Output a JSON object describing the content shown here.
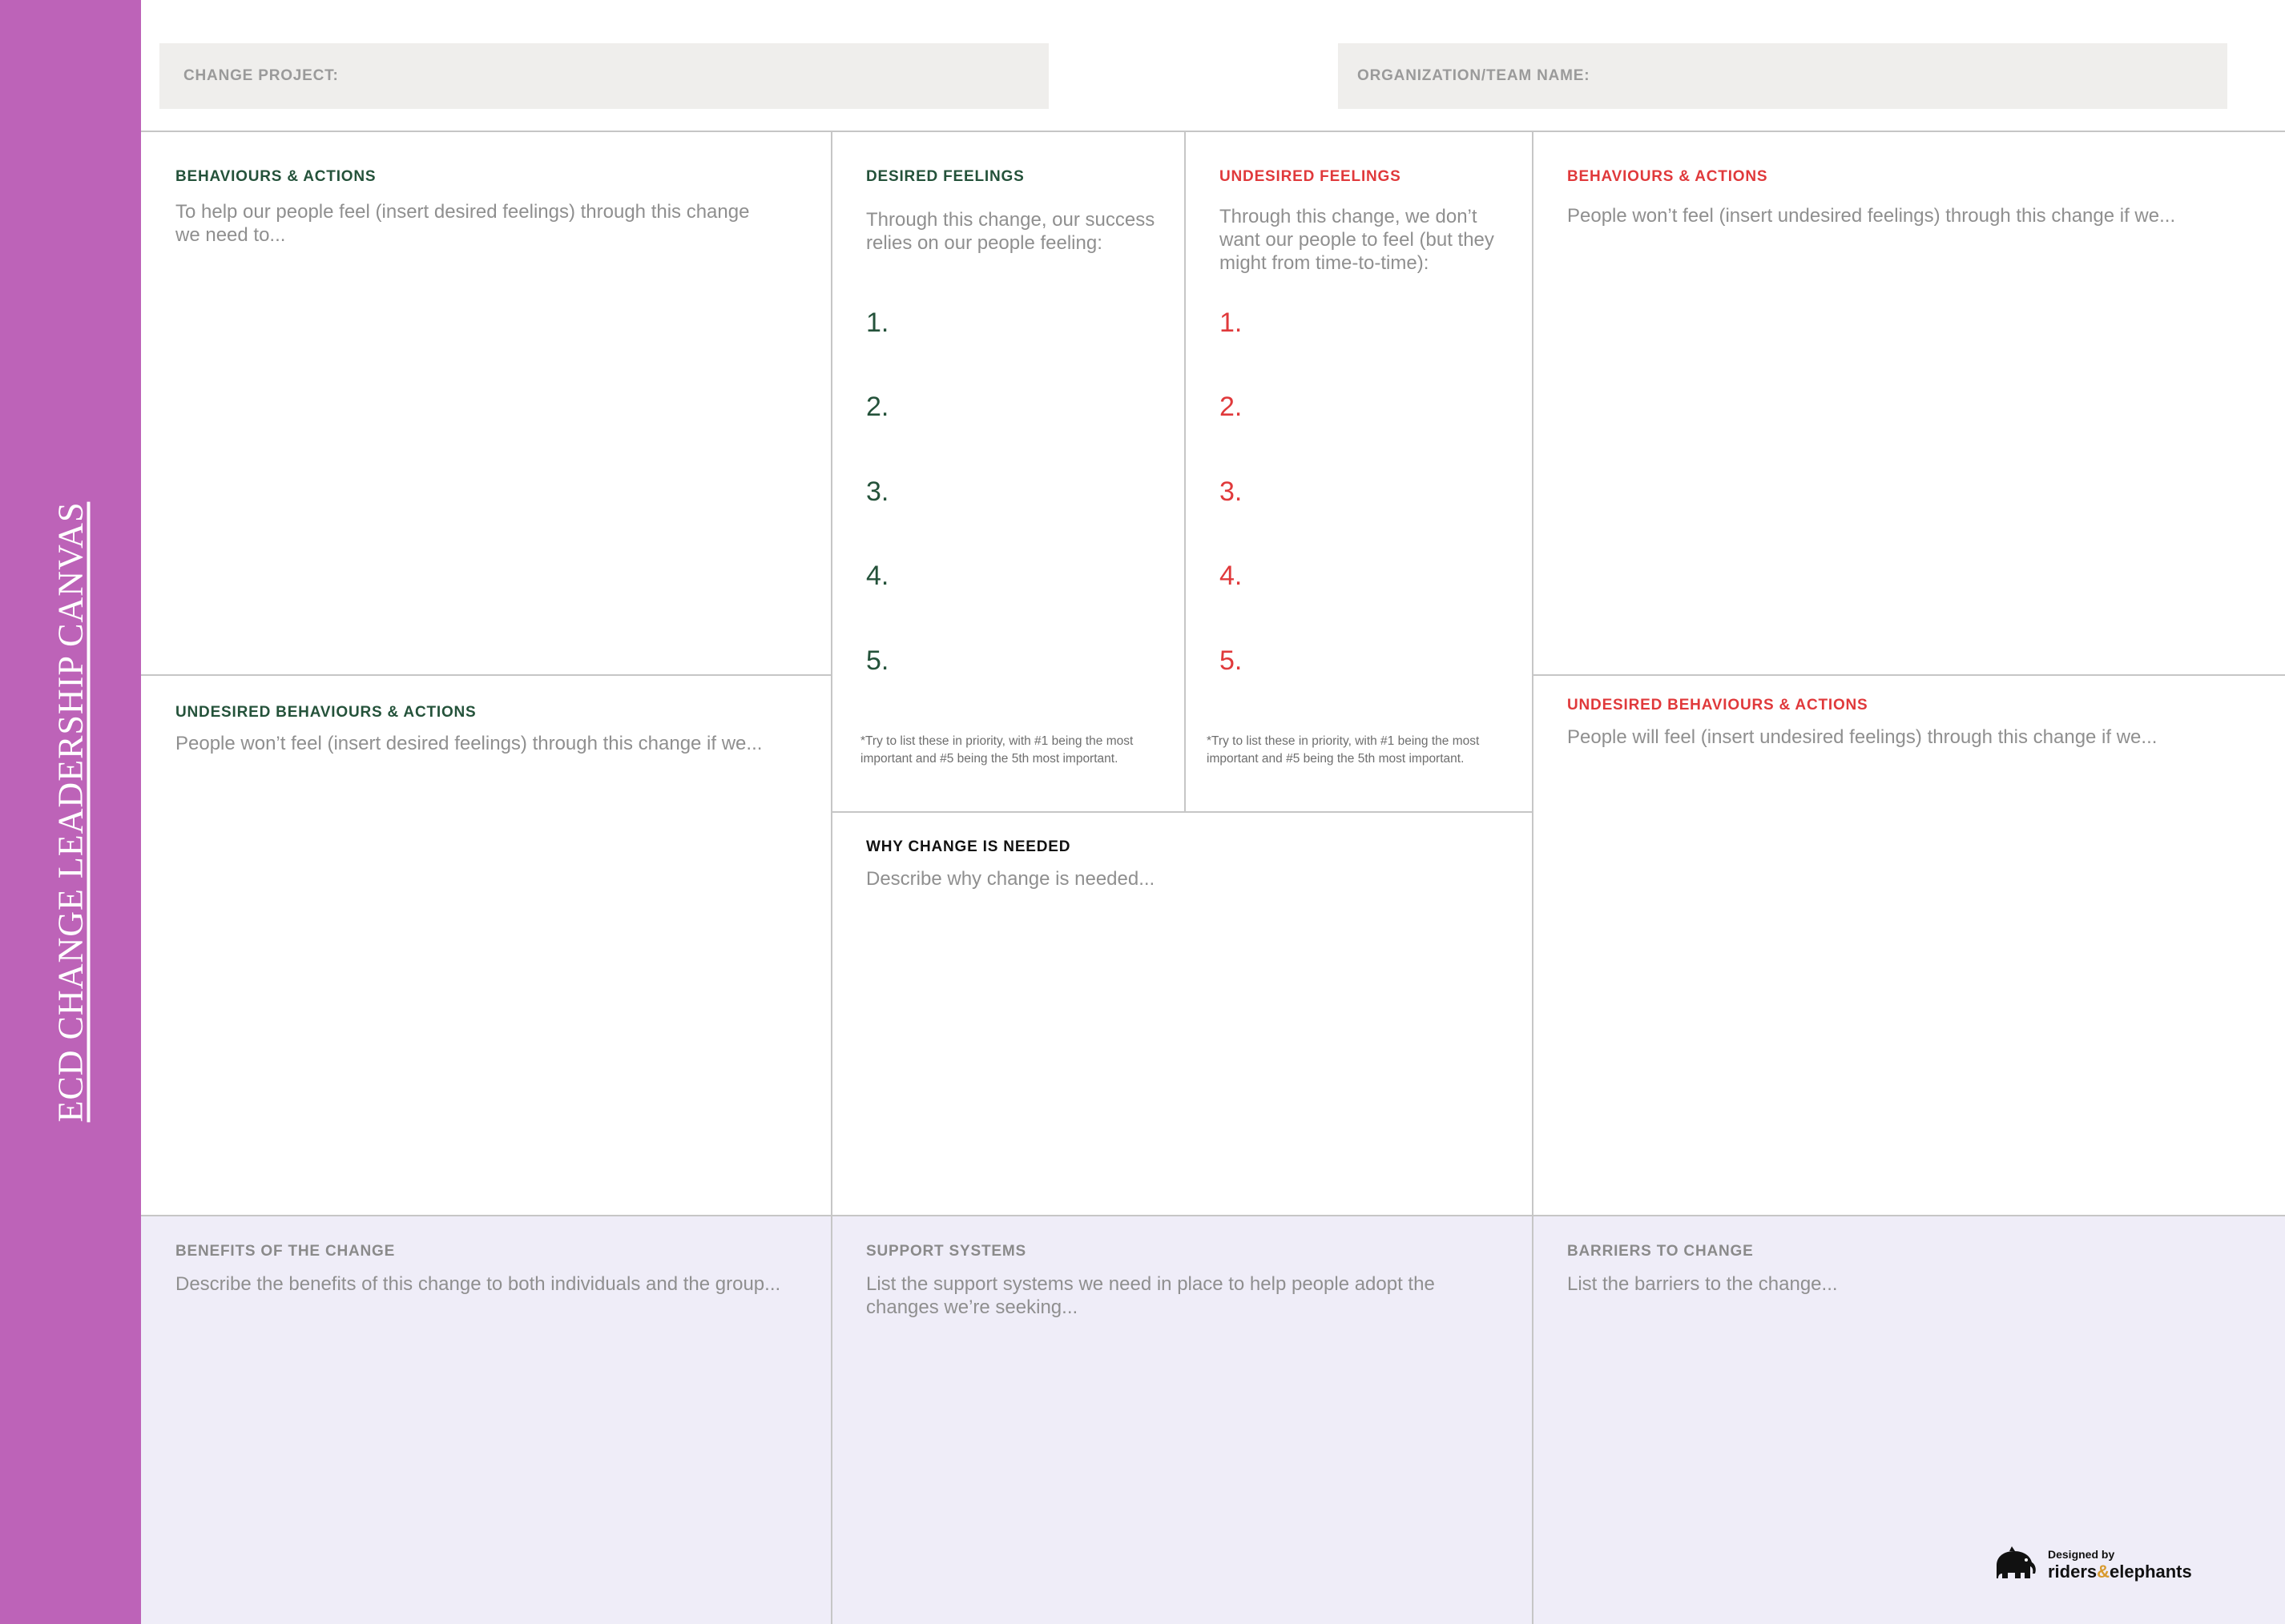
{
  "sidebar": {
    "title": "ECD CHANGE LEADERSHIP CANVAS",
    "color": "#bd63b8"
  },
  "header": {
    "change_project_label": "CHANGE PROJECT:",
    "organization_label": "ORGANIZATION/TEAM NAME:"
  },
  "sections": {
    "behaviours_actions": {
      "title": "BEHAVIOURS & ACTIONS",
      "description": "To help our people feel (insert desired feelings) through this change we need to..."
    },
    "undesired_behaviours_left": {
      "title": "UNDESIRED BEHAVIOURS & ACTIONS",
      "description": "People won’t feel (insert desired feelings) through this change if we..."
    },
    "desired_feelings": {
      "title": "DESIRED FEELINGS",
      "description": "Through this change, our success relies on our people feeling:",
      "numbers": [
        "1.",
        "2.",
        "3.",
        "4.",
        "5."
      ],
      "note": "*Try to list these in priority, with #1 being the most important and #5 being the 5th most important."
    },
    "undesired_feelings": {
      "title": "UNDESIRED FEELINGS",
      "description": "Through this change, we don’t want our people to feel (but they might from time-to-time):",
      "numbers": [
        "1.",
        "2.",
        "3.",
        "4.",
        "5."
      ],
      "note": "*Try to list these in priority, with #1 being the most important and #5 being the 5th most important."
    },
    "behaviours_actions_right": {
      "title": "BEHAVIOURS & ACTIONS",
      "description": "People won’t feel (insert undesired feelings) through this change if we..."
    },
    "undesired_behaviours_right": {
      "title": "UNDESIRED BEHAVIOURS & ACTIONS",
      "description": "People will feel (insert undesired feelings) through this change if we..."
    },
    "why_change": {
      "title": "WHY CHANGE IS NEEDED",
      "description": "Describe why change is needed..."
    },
    "benefits": {
      "title": "BENEFITS OF THE CHANGE",
      "description": "Describe the benefits of this change to both individuals and the group..."
    },
    "support_systems": {
      "title": "SUPPORT SYSTEMS",
      "description": "List the support systems we need in place to help people adopt the changes we’re seeking..."
    },
    "barriers": {
      "title": "BARRIERS TO CHANGE",
      "description": "List the barriers to the change..."
    }
  },
  "footer": {
    "designed_by": "Designed by",
    "brand_part1": "riders",
    "brand_amp": "&",
    "brand_part2": "elephants",
    "logo_icon": "elephant-icon"
  },
  "colors": {
    "green": "#24523a",
    "red": "#e0393b",
    "lavender": "#efedf8",
    "field_gray": "#efeeec"
  }
}
